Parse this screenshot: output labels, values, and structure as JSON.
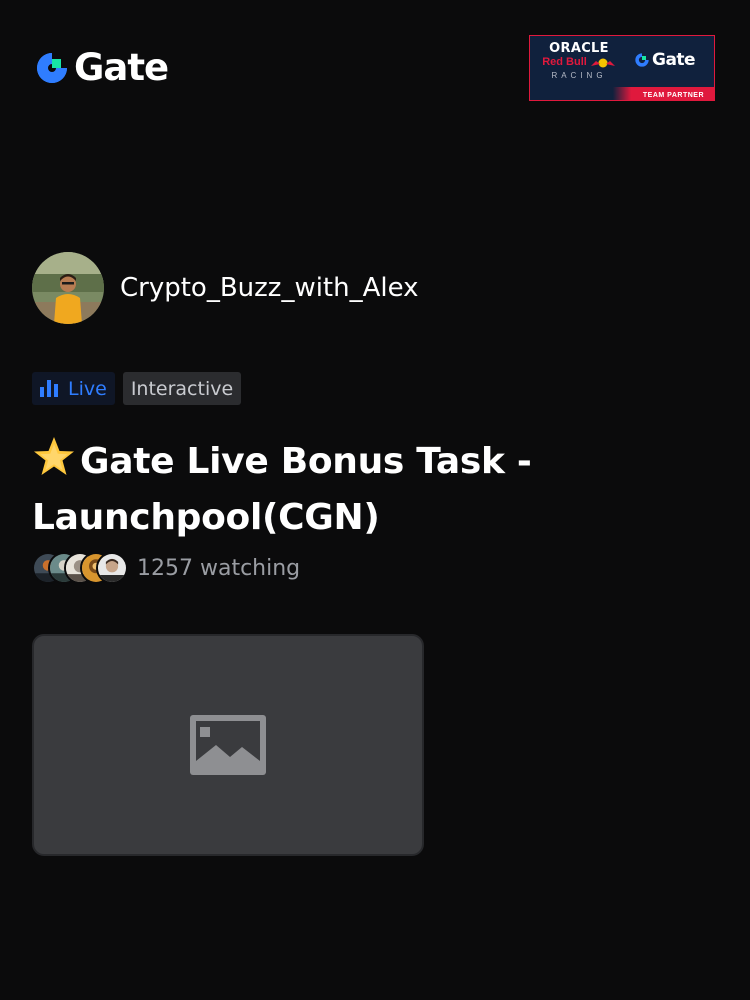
{
  "header": {
    "brand": "Gate",
    "brand_color": "#2f7dff",
    "partner_banner": {
      "line1": "ORACLE",
      "line2": "Red Bull",
      "line3": "RACING",
      "partner_brand": "Gate",
      "strip": "TEAM PARTNER"
    }
  },
  "host": {
    "name": "Crypto_Buzz_with_Alex"
  },
  "tags": {
    "live": "Live",
    "interactive": "Interactive",
    "live_color": "#2f7dff"
  },
  "stream": {
    "title_icon": "star-icon",
    "title": "Gate Live Bonus Task -Launchpool(CGN)",
    "watching": "1257 watching"
  },
  "thumbnail": {
    "icon": "image-placeholder-icon"
  }
}
